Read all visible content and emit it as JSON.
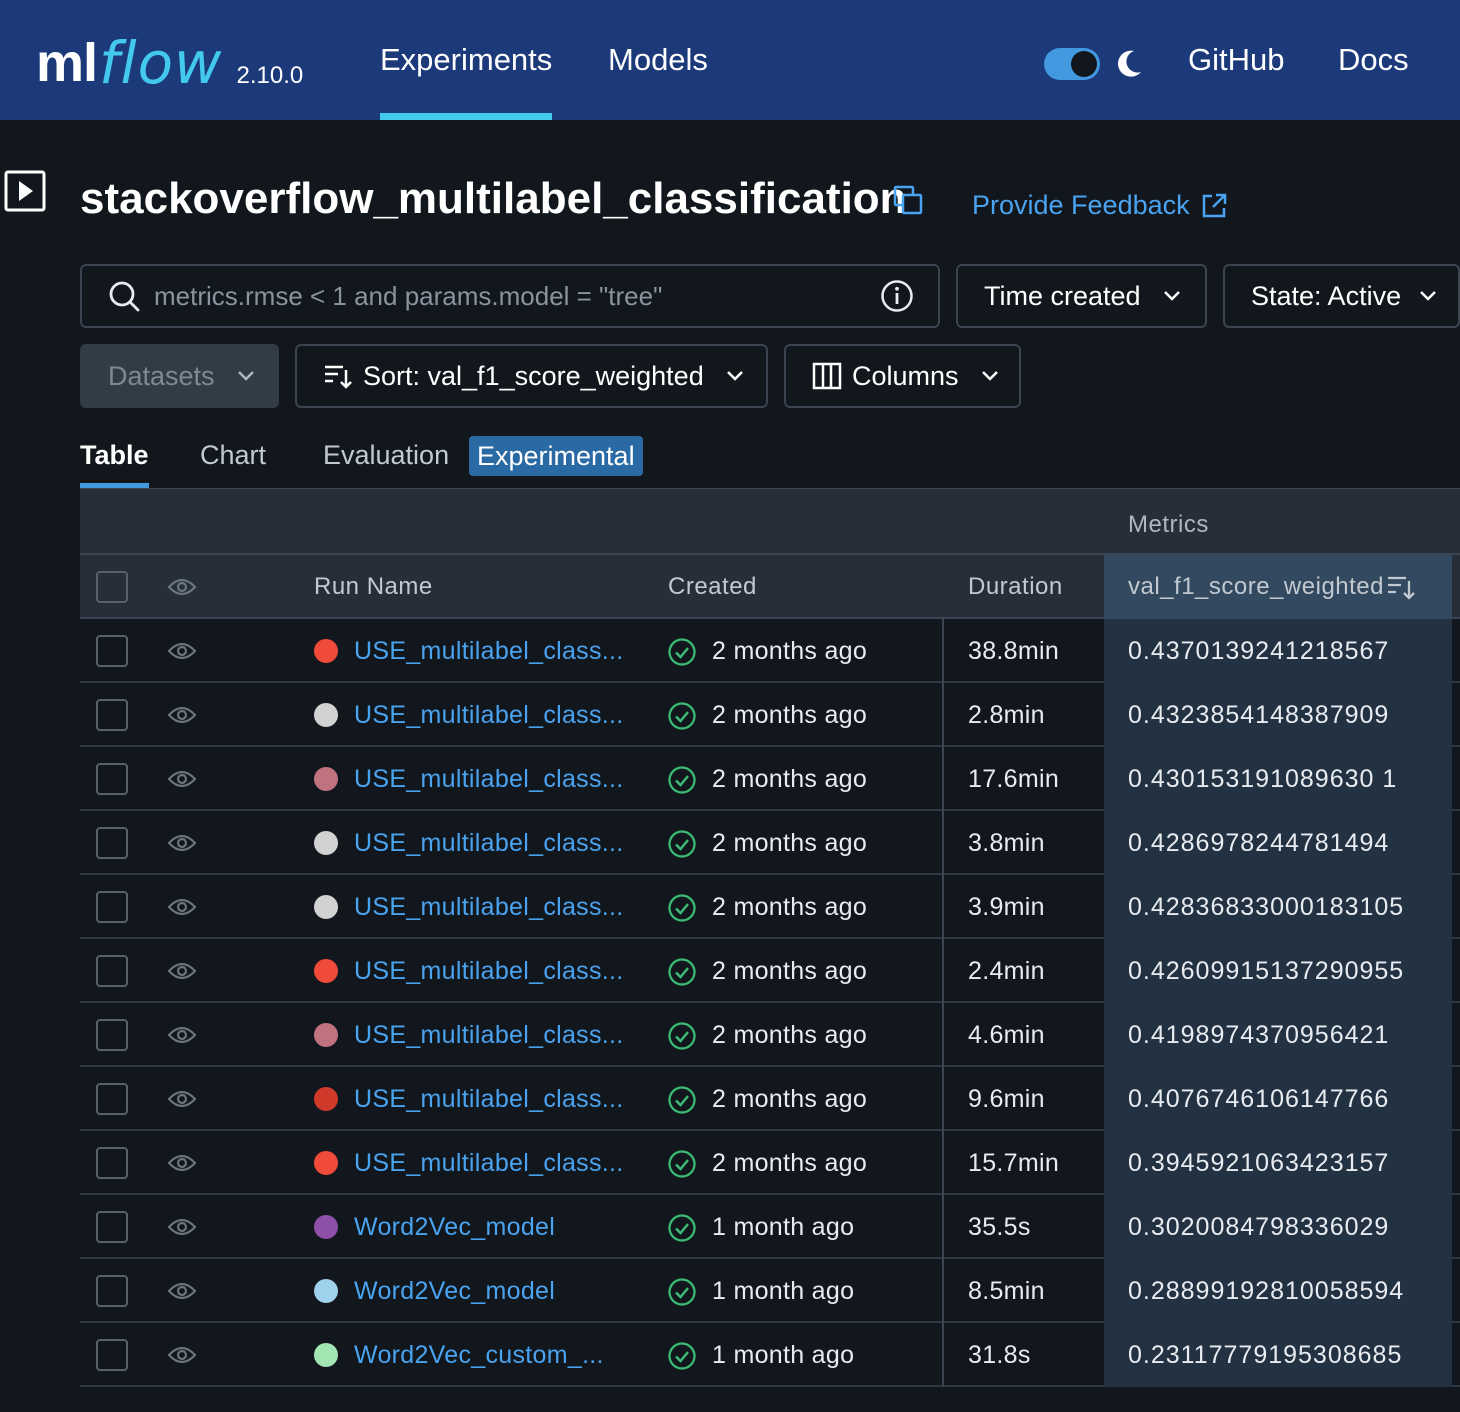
{
  "header": {
    "logo_ml": "ml",
    "logo_flow": "flow",
    "version": "2.10.0",
    "nav": [
      {
        "label": "Experiments",
        "active": true
      },
      {
        "label": "Models",
        "active": false
      }
    ],
    "links": [
      "GitHub",
      "Docs"
    ],
    "theme_toggle_on": true,
    "colors": {
      "bar": "#1c3a7a",
      "accent": "#43c9ed"
    }
  },
  "experiment": {
    "title": "stackoverflow_multilabel_classification",
    "feedback_label": "Provide Feedback"
  },
  "controls": {
    "search_placeholder": "metrics.rmse < 1 and params.model = \"tree\"",
    "time_filter": "Time created",
    "state_filter": "State: Active",
    "datasets": "Datasets",
    "sort": "Sort: val_f1_score_weighted",
    "columns": "Columns"
  },
  "tabs": [
    {
      "label": "Table",
      "active": true
    },
    {
      "label": "Chart",
      "active": false
    },
    {
      "label": "Evaluation",
      "active": false
    }
  ],
  "experimental_tag": "Experimental",
  "table": {
    "group_header": "Metrics",
    "columns": {
      "run_name": "Run Name",
      "created": "Created",
      "duration": "Duration",
      "metric": "val_f1_score_weighted"
    },
    "rows": [
      {
        "color": "#f04a3a",
        "name": "USE_multilabel_class...",
        "created": "2 months ago",
        "duration": "38.8min",
        "metric": "0.4370139241218567"
      },
      {
        "color": "#d2d2d2",
        "name": "USE_multilabel_class...",
        "created": "2 months ago",
        "duration": "2.8min",
        "metric": "0.4323854148387909"
      },
      {
        "color": "#c0737f",
        "name": "USE_multilabel_class...",
        "created": "2 months ago",
        "duration": "17.6min",
        "metric": "0.430153191089630 1"
      },
      {
        "color": "#d2d2d2",
        "name": "USE_multilabel_class...",
        "created": "2 months ago",
        "duration": "3.8min",
        "metric": "0.4286978244781494"
      },
      {
        "color": "#d2d2d2",
        "name": "USE_multilabel_class...",
        "created": "2 months ago",
        "duration": "3.9min",
        "metric": "0.42836833000183105"
      },
      {
        "color": "#f04a3a",
        "name": "USE_multilabel_class...",
        "created": "2 months ago",
        "duration": "2.4min",
        "metric": "0.42609915137290955"
      },
      {
        "color": "#c0737f",
        "name": "USE_multilabel_class...",
        "created": "2 months ago",
        "duration": "4.6min",
        "metric": "0.4198974370956421"
      },
      {
        "color": "#cf3a2b",
        "name": "USE_multilabel_class...",
        "created": "2 months ago",
        "duration": "9.6min",
        "metric": "0.4076746106147766"
      },
      {
        "color": "#f04a3a",
        "name": "USE_multilabel_class...",
        "created": "2 months ago",
        "duration": "15.7min",
        "metric": "0.3945921063423157"
      },
      {
        "color": "#8e4fa8",
        "name": "Word2Vec_model",
        "created": "1 month ago",
        "duration": "35.5s",
        "metric": "0.3020084798336029"
      },
      {
        "color": "#9fd0ec",
        "name": "Word2Vec_model",
        "created": "1 month ago",
        "duration": "8.5min",
        "metric": "0.28899192810058594"
      },
      {
        "color": "#a3e6b4",
        "name": "Word2Vec_custom_...",
        "created": "1 month ago",
        "duration": "31.8s",
        "metric": "0.23117779195308685"
      }
    ]
  }
}
